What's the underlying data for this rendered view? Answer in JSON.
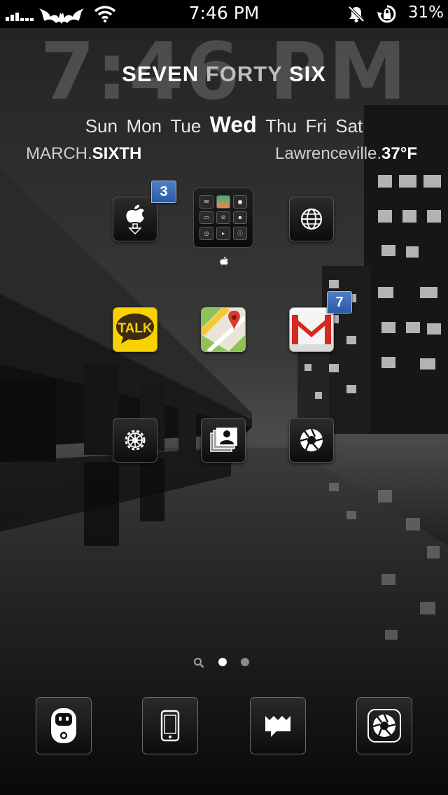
{
  "status_bar": {
    "time": "7:46 PM",
    "battery": "31%"
  },
  "clock_widget": {
    "big_time": "7:46 PM",
    "word_time": [
      "SEVEN",
      "FORTY",
      "SIX"
    ],
    "weekdays": [
      "Sun",
      "Mon",
      "Tue",
      "Wed",
      "Thu",
      "Fri",
      "Sat"
    ],
    "active_day": "Wed",
    "date_month": "MARCH.",
    "date_day": "SIXTH",
    "weather_city": "Lawrenceville.",
    "weather_temp": "37°F"
  },
  "apps": {
    "app_store": {
      "icon": "apple-download-icon",
      "badge": "3"
    },
    "folder": {
      "label_icon": "apple-icon"
    },
    "browser": {
      "icon": "globe-icon"
    },
    "talk": {
      "label": "TALK",
      "icon": "kakaotalk-icon"
    },
    "maps": {
      "icon": "maps-icon"
    },
    "gmail": {
      "icon": "gmail-icon",
      "badge": "7"
    },
    "settings": {
      "icon": "gear-icon"
    },
    "contacts": {
      "icon": "contacts-icon"
    },
    "camera": {
      "icon": "camera-aperture-icon"
    }
  },
  "page_indicator": {
    "pages": 2,
    "current": 1
  },
  "dock": [
    "robot-app-icon",
    "phone-icon",
    "messages-icon",
    "camera-icon"
  ],
  "colors": {
    "badge_blue": "#3a6fc0",
    "talk_yellow": "#f7d100",
    "gmail_red": "#d8281f"
  }
}
